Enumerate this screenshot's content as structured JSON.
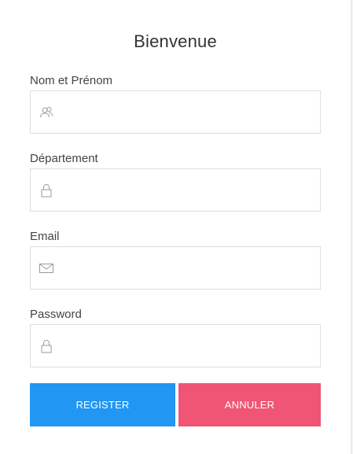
{
  "form": {
    "title": "Bienvenue",
    "fields": [
      {
        "label": "Nom et Prénom",
        "value": "",
        "placeholder": "",
        "icon": "users-icon"
      },
      {
        "label": "Département",
        "value": "",
        "placeholder": "",
        "icon": "lock-icon"
      },
      {
        "label": "Email",
        "value": "",
        "placeholder": "",
        "icon": "envelope-icon"
      },
      {
        "label": "Password",
        "value": "",
        "placeholder": "",
        "icon": "lock-icon"
      }
    ],
    "register_label": "REGISTER",
    "cancel_label": "ANNULER"
  },
  "colors": {
    "register": "#2196f3",
    "cancel": "#f05575",
    "icon": "#999999"
  }
}
